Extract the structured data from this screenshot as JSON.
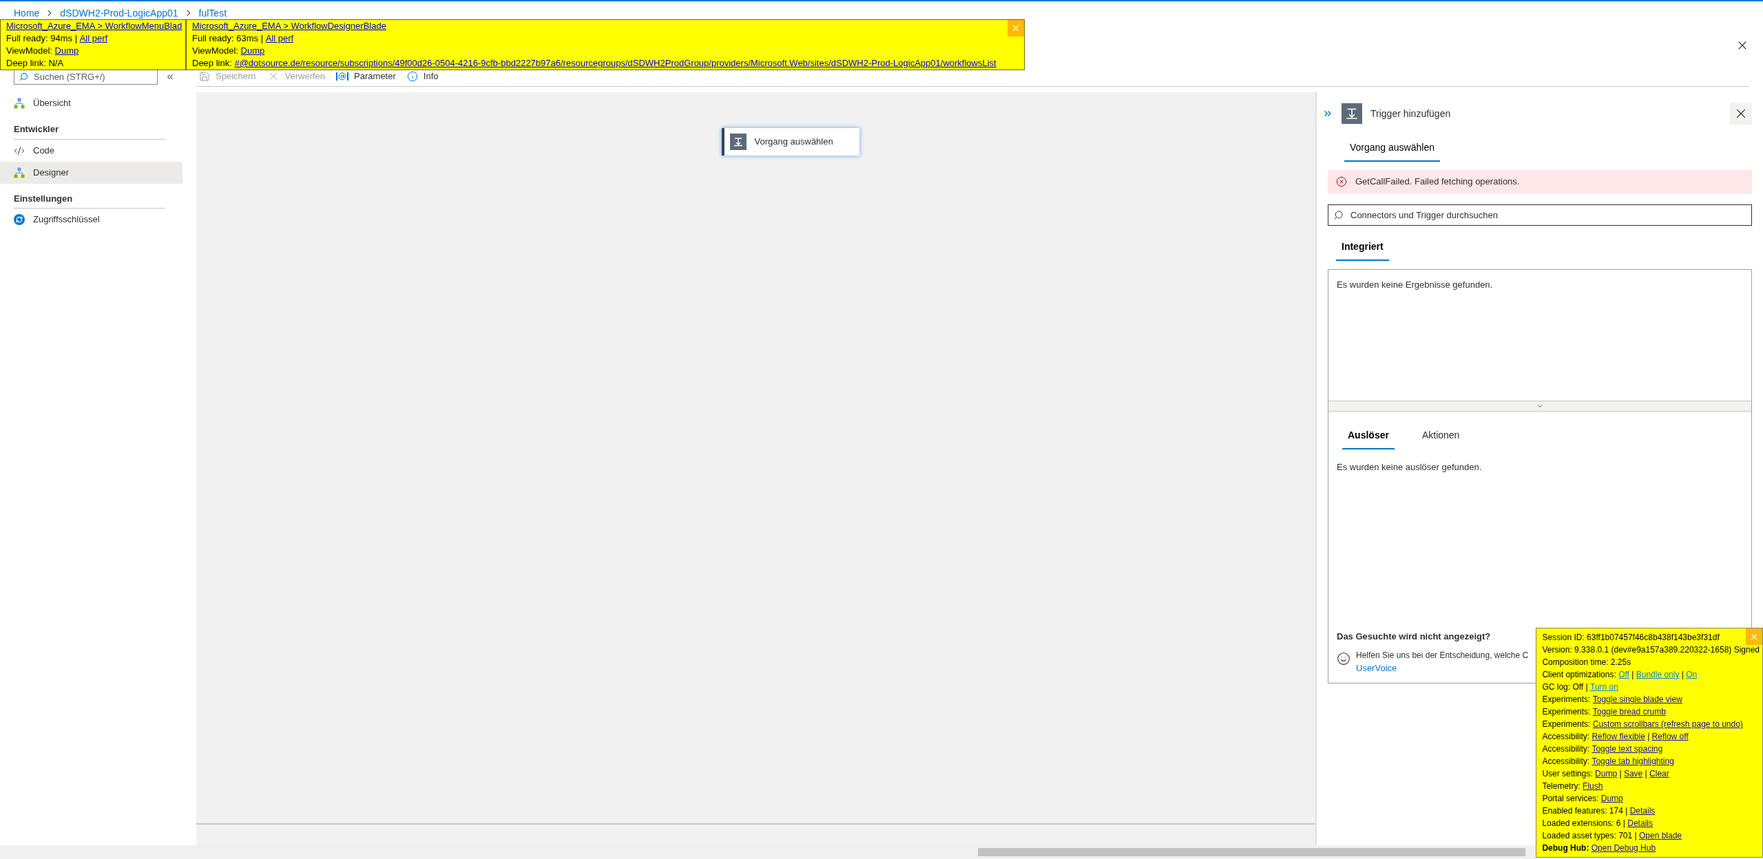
{
  "breadcrumb": [
    {
      "label": "Home"
    },
    {
      "label": "dSDWH2-Prod-LogicApp01"
    },
    {
      "label": "fulTest"
    }
  ],
  "perf_panels": [
    {
      "closable": false,
      "lines": [
        [
          {
            "kind": "link",
            "text": "Microsoft_Azure_EMA > WorkflowMenuBlad"
          }
        ],
        [
          {
            "kind": "text",
            "text": "Full ready: 94ms | "
          },
          {
            "kind": "link",
            "text": "All perf"
          }
        ],
        [
          {
            "kind": "text",
            "text": "ViewModel: "
          },
          {
            "kind": "link",
            "text": "Dump"
          }
        ],
        [
          {
            "kind": "text",
            "text": "Deep link: N/A"
          }
        ]
      ]
    },
    {
      "closable": true,
      "lines": [
        [
          {
            "kind": "link",
            "text": "Microsoft_Azure_EMA > WorkflowDesignerBlade"
          }
        ],
        [
          {
            "kind": "text",
            "text": "Full ready: 63ms | "
          },
          {
            "kind": "link",
            "text": "All perf"
          }
        ],
        [
          {
            "kind": "text",
            "text": "ViewModel: "
          },
          {
            "kind": "link",
            "text": "Dump"
          }
        ],
        [
          {
            "kind": "text",
            "text": "Deep link: "
          },
          {
            "kind": "link",
            "text": "#@dotsource.de/resource/subscriptions/49f00d26-0504-4216-9cfb-bbd2227b97a6/resourcegroups/dSDWH2ProdGroup/providers/Microsoft.Web/sites/dSDWH2-Prod-LogicApp01/workflowsList"
          }
        ]
      ]
    }
  ],
  "sidebar": {
    "search": {
      "placeholder": "Suchen (STRG+/)"
    },
    "collapse": "«",
    "items": [
      {
        "kind": "item",
        "label": "Übersicht",
        "selected": false
      },
      {
        "kind": "section",
        "label": "Entwickler"
      },
      {
        "kind": "item",
        "label": "Code",
        "selected": false
      },
      {
        "kind": "item",
        "label": "Designer",
        "selected": true
      },
      {
        "kind": "section",
        "label": "Einstellungen"
      },
      {
        "kind": "item",
        "label": "Zugriffsschlüssel",
        "selected": false
      }
    ]
  },
  "toolbar": [
    {
      "label": "Speichern",
      "disabled": true
    },
    {
      "label": "Verwerfen",
      "disabled": true
    },
    {
      "label": "Parameter",
      "disabled": false
    },
    {
      "label": "Info",
      "disabled": false
    }
  ],
  "canvas": {
    "node": "Vorgang auswählen"
  },
  "panel": {
    "title": "Trigger hinzufügen",
    "tabs": [
      {
        "label": "Vorgang auswählen",
        "selected": true
      }
    ],
    "error": "GetCallFailed. Failed fetching operations.",
    "search": {
      "placeholder": "Connectors und Trigger durchsuchen"
    },
    "group_tabs": [
      {
        "label": "Integriert",
        "selected": true
      }
    ],
    "results_text": "Es wurden keine Ergebnisse gefunden.",
    "type_tabs": [
      {
        "label": "Auslöser",
        "selected": true
      },
      {
        "label": "Aktionen",
        "selected": false
      }
    ],
    "empty_text": "Es wurden keine auslöser gefunden.",
    "feedback_title": "Das Gesuchte wird nicht angezeigt?",
    "feedback_text": "Helfen Sie uns bei der Entscheidung, welche C",
    "feedback_link": "UserVoice"
  },
  "debug_hub": {
    "closable": true,
    "lines": [
      [
        {
          "kind": "text",
          "text": "Session ID: 63ff1b07457f46c8b438f143be3f31df"
        }
      ],
      [
        {
          "kind": "text",
          "text": "Version: 9.338.0.1 (dev#e9a157a389.220322-1658) Signed"
        }
      ],
      [
        {
          "kind": "text",
          "text": "Composition time: 2.25s"
        }
      ],
      [
        {
          "kind": "text",
          "text": "Client optimizations: "
        },
        {
          "kind": "link",
          "text": "Off",
          "visited": false
        },
        {
          "kind": "text",
          "text": " | "
        },
        {
          "kind": "link",
          "text": "Bundle only",
          "visited": false
        },
        {
          "kind": "text",
          "text": " | "
        },
        {
          "kind": "link",
          "text": "On",
          "visited": false
        }
      ],
      [
        {
          "kind": "text",
          "text": "GC log: Off | "
        },
        {
          "kind": "link",
          "text": "Turn on",
          "visited": false
        }
      ],
      [
        {
          "kind": "text",
          "text": "Experiments: "
        },
        {
          "kind": "link",
          "text": "Toggle single blade view",
          "visited": true
        }
      ],
      [
        {
          "kind": "text",
          "text": "Experiments: "
        },
        {
          "kind": "link",
          "text": "Toggle bread crumb",
          "visited": true
        }
      ],
      [
        {
          "kind": "text",
          "text": "Experiments: "
        },
        {
          "kind": "link",
          "text": "Custom scrollbars (refresh page to undo)",
          "visited": true
        }
      ],
      [
        {
          "kind": "text",
          "text": "Accessibility: "
        },
        {
          "kind": "link",
          "text": "Reflow flexible",
          "visited": true
        },
        {
          "kind": "text",
          "text": " | "
        },
        {
          "kind": "link",
          "text": "Reflow off",
          "visited": true
        }
      ],
      [
        {
          "kind": "text",
          "text": "Accessibility: "
        },
        {
          "kind": "link",
          "text": "Toggle text spacing",
          "visited": true
        }
      ],
      [
        {
          "kind": "text",
          "text": "Accessibility: "
        },
        {
          "kind": "link",
          "text": "Toggle tab highlighting",
          "visited": true
        }
      ],
      [
        {
          "kind": "text",
          "text": "User settings: "
        },
        {
          "kind": "link",
          "text": "Dump",
          "visited": true
        },
        {
          "kind": "text",
          "text": " | "
        },
        {
          "kind": "link",
          "text": "Save",
          "visited": true
        },
        {
          "kind": "text",
          "text": " | "
        },
        {
          "kind": "link",
          "text": "Clear",
          "visited": true
        }
      ],
      [
        {
          "kind": "text",
          "text": "Telemetry: "
        },
        {
          "kind": "link",
          "text": "Flush",
          "visited": true
        }
      ],
      [
        {
          "kind": "text",
          "text": "Portal services: "
        },
        {
          "kind": "link",
          "text": "Dump",
          "visited": true
        }
      ],
      [
        {
          "kind": "text",
          "text": "Enabled features: 174 | "
        },
        {
          "kind": "link",
          "text": "Details",
          "visited": true
        }
      ],
      [
        {
          "kind": "text",
          "text": "Loaded extensions: 6 | "
        },
        {
          "kind": "link",
          "text": "Details",
          "visited": true
        }
      ],
      [
        {
          "kind": "text",
          "text": "Loaded asset types: 701 | "
        },
        {
          "kind": "link",
          "text": "Open blade",
          "visited": true
        }
      ],
      [
        {
          "kind": "bold",
          "text": "Debug Hub: "
        },
        {
          "kind": "link",
          "text": "Open Debug Hub",
          "visited": true
        }
      ]
    ]
  }
}
